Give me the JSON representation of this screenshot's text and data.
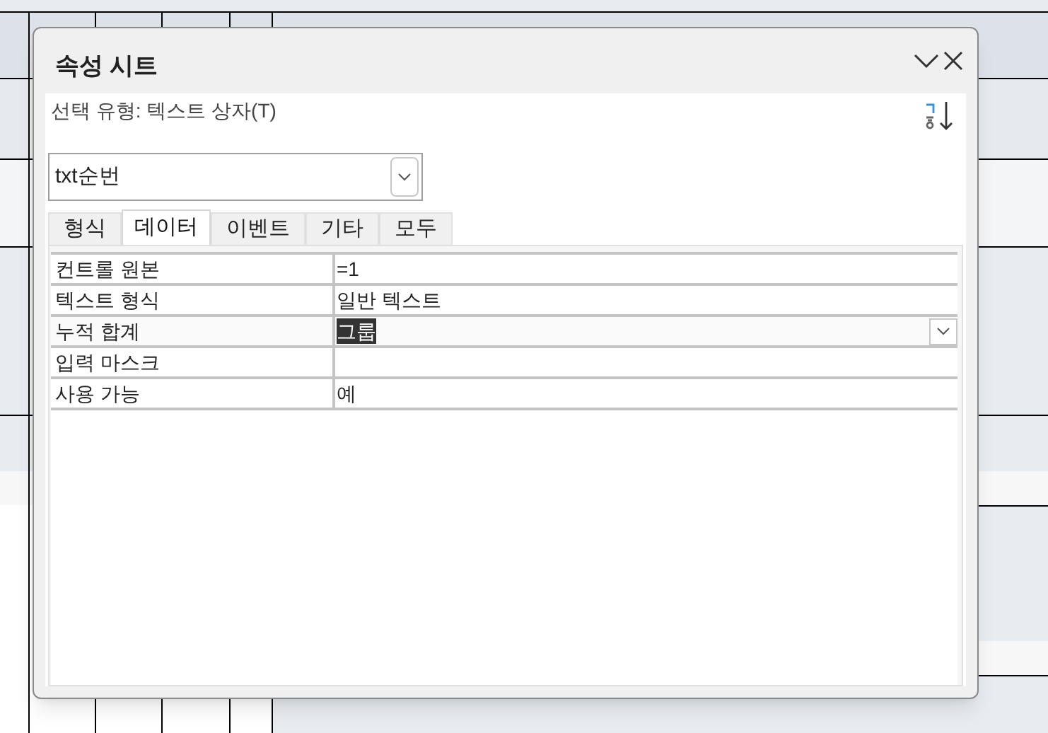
{
  "panel": {
    "title": "속성 시트",
    "selection_type": "선택 유형: 텍스트 상자(T)"
  },
  "object_dropdown": {
    "value": "txt순번"
  },
  "tabs": [
    {
      "label": "형식",
      "selected": false
    },
    {
      "label": "데이터",
      "selected": true
    },
    {
      "label": "이벤트",
      "selected": false
    },
    {
      "label": "기타",
      "selected": false
    },
    {
      "label": "모두",
      "selected": false
    }
  ],
  "properties": [
    {
      "name": "컨트롤 원본",
      "value": "=1",
      "selected": false,
      "dropdown": false
    },
    {
      "name": "텍스트 형식",
      "value": "일반 텍스트",
      "selected": false,
      "dropdown": false
    },
    {
      "name": "누적 합계",
      "value": "그룹",
      "selected": true,
      "dropdown": true
    },
    {
      "name": "입력 마스크",
      "selected": false,
      "dropdown": false
    },
    {
      "name": "사용 가능",
      "value": "예",
      "selected": false,
      "dropdown": false
    }
  ]
}
